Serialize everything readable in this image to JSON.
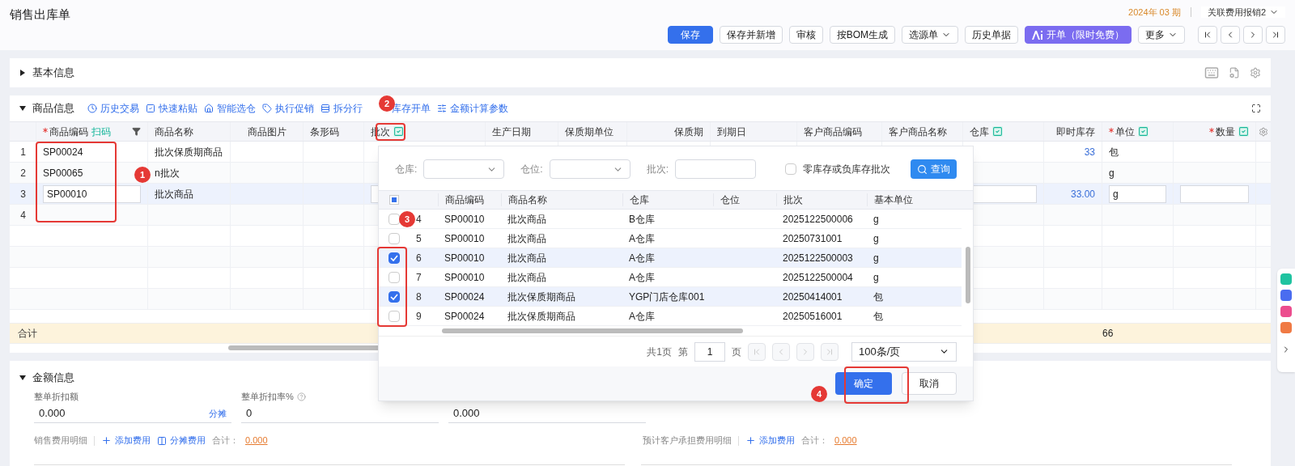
{
  "page_title": "销售出库单",
  "period": "2024年 03 期",
  "linked_dropdown": {
    "label": "关联费用报销2"
  },
  "toolbar_buttons": [
    {
      "label": "保存",
      "kind": "primary"
    },
    {
      "label": "保存并新增",
      "kind": "default"
    },
    {
      "label": "审核",
      "kind": "default"
    },
    {
      "label": "按BOM生成",
      "kind": "default"
    },
    {
      "label": "选源单",
      "kind": "dropdown"
    },
    {
      "label": "历史单据",
      "kind": "default"
    },
    {
      "label": "开单（限时免费）",
      "kind": "ai"
    },
    {
      "label": "更多",
      "kind": "dropdown"
    }
  ],
  "basic_info": {
    "title": "基本信息",
    "expanded": false
  },
  "goods_info": {
    "title": "商品信息",
    "expanded": true,
    "actions": [
      "历史交易",
      "快速粘贴",
      "智能选仓",
      "执行促销",
      "拆分行",
      "库存开单",
      "金额计算参数"
    ],
    "columns": [
      {
        "label": "商品编码",
        "required": true,
        "scan_label": "扫码",
        "bulk_edit": false
      },
      {
        "label": "商品名称",
        "required": false,
        "bulk_edit": false
      },
      {
        "label": "商品图片",
        "required": false,
        "bulk_edit": false
      },
      {
        "label": "条形码",
        "required": false,
        "bulk_edit": false
      },
      {
        "label": "批次",
        "required": false,
        "bulk_edit": true
      },
      {
        "label": "生产日期",
        "required": false,
        "bulk_edit": false
      },
      {
        "label": "保质期单位",
        "required": false,
        "bulk_edit": false
      },
      {
        "label": "保质期",
        "required": false,
        "bulk_edit": false
      },
      {
        "label": "到期日",
        "required": false,
        "bulk_edit": false
      },
      {
        "label": "客户商品编码",
        "required": false,
        "bulk_edit": false
      },
      {
        "label": "客户商品名称",
        "required": false,
        "bulk_edit": false
      },
      {
        "label": "仓库",
        "required": false,
        "bulk_edit": true
      },
      {
        "label": "即时库存",
        "required": false,
        "bulk_edit": false
      },
      {
        "label": "单位",
        "required": true,
        "bulk_edit": true
      },
      {
        "label": "数量",
        "required": true,
        "bulk_edit": true
      }
    ],
    "rows": [
      {
        "number": "1",
        "selected": false,
        "cells": [
          {
            "kind": "text",
            "text": "SP00024"
          },
          {
            "kind": "text",
            "text": "批次保质期商品"
          },
          null,
          null,
          null,
          null,
          null,
          null,
          null,
          null,
          null,
          null,
          {
            "kind": "number",
            "text": "33"
          },
          {
            "kind": "text",
            "text": "包"
          },
          null
        ]
      },
      {
        "number": "2",
        "selected": false,
        "cells": [
          {
            "kind": "text",
            "text": "SP00065"
          },
          {
            "kind": "text",
            "text": "n批次"
          },
          null,
          null,
          null,
          null,
          null,
          null,
          null,
          null,
          null,
          null,
          null,
          {
            "kind": "text",
            "text": "g"
          },
          null
        ]
      },
      {
        "number": "3",
        "selected": true,
        "cells": [
          {
            "kind": "input",
            "value": "SP00010"
          },
          {
            "kind": "text",
            "text": "批次商品"
          },
          null,
          null,
          {
            "kind": "input"
          },
          null,
          null,
          null,
          null,
          null,
          null,
          {
            "kind": "input"
          },
          {
            "kind": "number",
            "text": "33.00"
          },
          {
            "kind": "input",
            "value": "g"
          },
          {
            "kind": "input"
          }
        ]
      },
      {
        "number": "4",
        "selected": false,
        "cells": [
          null,
          null,
          null,
          null,
          null,
          null,
          null,
          null,
          null,
          null,
          null,
          null,
          null,
          null,
          null
        ]
      }
    ],
    "total_row": {
      "label": "合计",
      "stock_total": "66"
    }
  },
  "batch_dialog": {
    "filters": [
      {
        "label": "仓库:",
        "kind": "select"
      },
      {
        "label": "仓位:",
        "kind": "select"
      },
      {
        "label": "批次:",
        "kind": "input"
      }
    ],
    "zero_stock_option": {
      "label": "零库存或负库存批次",
      "checked": false
    },
    "query_button": "查询",
    "select_all_indeterminate": true,
    "columns": [
      "商品编码",
      "商品名称",
      "仓库",
      "仓位",
      "批次",
      "基本单位"
    ],
    "rows": [
      {
        "number": "4",
        "checked": false,
        "cells": [
          "SP00010",
          "批次商品",
          "B仓库",
          "",
          "2025122500006",
          "g"
        ]
      },
      {
        "number": "5",
        "checked": false,
        "cells": [
          "SP00010",
          "批次商品",
          "A仓库",
          "",
          "20250731001",
          "g"
        ]
      },
      {
        "number": "6",
        "checked": true,
        "cells": [
          "SP00010",
          "批次商品",
          "A仓库",
          "",
          "2025122500003",
          "g"
        ]
      },
      {
        "number": "7",
        "checked": false,
        "cells": [
          "SP00010",
          "批次商品",
          "A仓库",
          "",
          "2025122500004",
          "g"
        ]
      },
      {
        "number": "8",
        "checked": true,
        "cells": [
          "SP00024",
          "批次保质期商品",
          "YGP门店仓库001",
          "",
          "20250414001",
          "包"
        ]
      },
      {
        "number": "9",
        "checked": false,
        "cells": [
          "SP00024",
          "批次保质期商品",
          "A仓库",
          "",
          "20250516001",
          "包"
        ]
      }
    ],
    "pagination": {
      "total_pages": "共1页",
      "page_prefix": "第",
      "page": "1",
      "page_suffix": "页",
      "nav_disabled": true,
      "page_size": "100条/页"
    },
    "confirm_button": "确定",
    "cancel_button": "取消"
  },
  "amount_info": {
    "title": "金额信息",
    "expanded": true,
    "fields": [
      {
        "label": "整单折扣额",
        "value": "0.000",
        "link": "分摊",
        "help": false
      },
      {
        "label": "整单折扣率%",
        "value": "0",
        "help": true
      },
      {
        "value": "0.000"
      }
    ],
    "expense_rows": [
      {
        "label": "销售费用明细",
        "actions": [
          "添加费用",
          "分摊费用"
        ],
        "total_label": "合计：",
        "total": "0.000"
      },
      {
        "label": "预计客户承担费用明细",
        "actions": [
          "添加费用"
        ],
        "total_label": "合计：",
        "total": "0.000"
      }
    ]
  },
  "markers": [
    "1",
    "2",
    "3",
    "4"
  ]
}
